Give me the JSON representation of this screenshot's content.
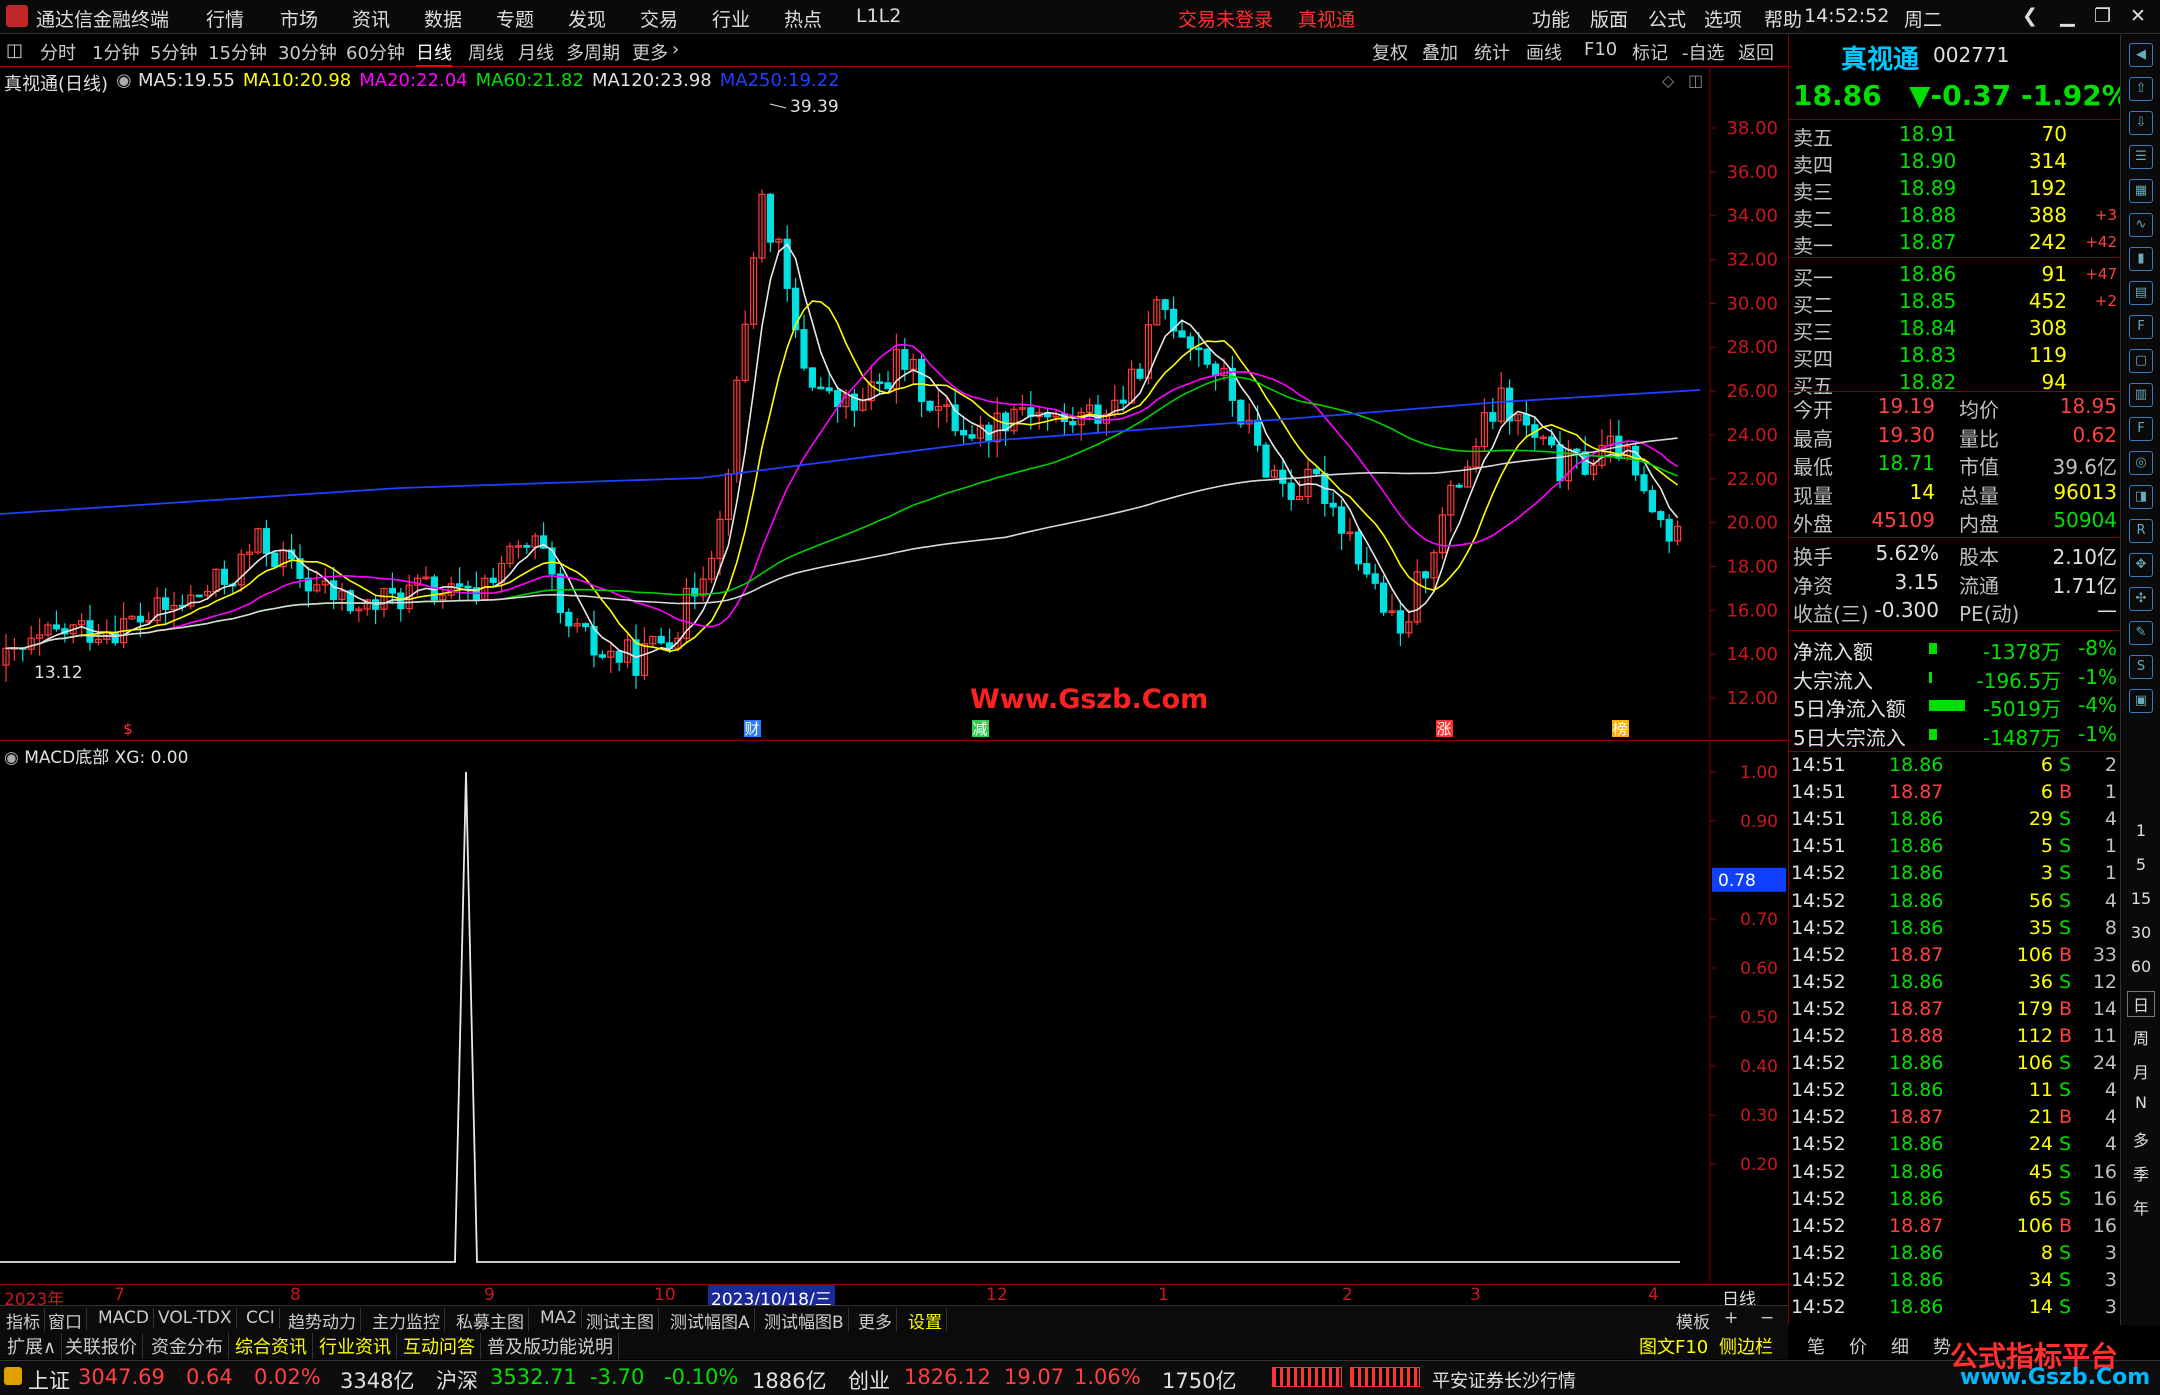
{
  "window": {
    "title": "通达信金融终端",
    "menus": [
      "行情",
      "市场",
      "资讯",
      "数据",
      "专题",
      "发现",
      "交易",
      "行业",
      "热点",
      "L1L2"
    ],
    "trade_status": "交易未登录",
    "stock_link": "真视通",
    "right_menus": [
      "功能",
      "版面",
      "公式",
      "选项",
      "帮助"
    ],
    "clock": "14:52:52",
    "weekday": "周二"
  },
  "period_bar": {
    "items": [
      "分时",
      "1分钟",
      "5分钟",
      "15分钟",
      "30分钟",
      "60分钟",
      "日线",
      "周线",
      "月线",
      "多周期",
      "更多"
    ],
    "active": "日线",
    "right_items": [
      "复权",
      "叠加",
      "统计",
      "画线",
      "F10",
      "标记",
      "-自选",
      "返回"
    ]
  },
  "chart": {
    "title": "真视通(日线)",
    "ma": [
      {
        "label": "MA5:",
        "value": "19.55",
        "color": "#e0e0e0"
      },
      {
        "label": "MA10:",
        "value": "20.98",
        "color": "#ffff00"
      },
      {
        "label": "MA20:",
        "value": "22.04",
        "color": "#ff00ff"
      },
      {
        "label": "MA60:",
        "value": "21.82",
        "color": "#00e000"
      },
      {
        "label": "MA120:",
        "value": "23.98",
        "color": "#e0e0e0"
      },
      {
        "label": "MA250:",
        "value": "19.22",
        "color": "#2040ff"
      }
    ],
    "high_label": "39.39",
    "low_label": "13.12",
    "watermark": "Www.Gszb.Com",
    "markers": [
      "$",
      "财",
      "减",
      "涨",
      "榜"
    ],
    "y_ticks": [
      "38.00",
      "36.00",
      "34.00",
      "32.00",
      "30.00",
      "28.00",
      "26.00",
      "24.00",
      "22.00",
      "20.00",
      "18.00",
      "16.00",
      "14.00",
      "12.00"
    ]
  },
  "indicator": {
    "title": "MACD底部",
    "xg_label": "XG:",
    "xg_value": "0.00",
    "y_ticks": [
      "1.00",
      "0.90",
      "0.78",
      "0.70",
      "0.60",
      "0.50",
      "0.40",
      "0.30",
      "0.20"
    ],
    "current": "0.78"
  },
  "x_axis": {
    "labels": [
      "2023年",
      "7",
      "8",
      "9",
      "10",
      "2023/10/18/三",
      "12",
      "1",
      "2",
      "3",
      "4"
    ],
    "period": "日线"
  },
  "quote": {
    "name": "真视通",
    "code": "002771",
    "price": "18.86",
    "change": "▼-0.37",
    "pct": "-1.92%",
    "asks": [
      {
        "l": "卖五",
        "p": "18.91",
        "v": "70",
        "d": ""
      },
      {
        "l": "卖四",
        "p": "18.90",
        "v": "314",
        "d": ""
      },
      {
        "l": "卖三",
        "p": "18.89",
        "v": "192",
        "d": ""
      },
      {
        "l": "卖二",
        "p": "18.88",
        "v": "388",
        "d": "+3"
      },
      {
        "l": "卖一",
        "p": "18.87",
        "v": "242",
        "d": "+42"
      }
    ],
    "bids": [
      {
        "l": "买一",
        "p": "18.86",
        "v": "91",
        "d": "+47"
      },
      {
        "l": "买二",
        "p": "18.85",
        "v": "452",
        "d": "+2"
      },
      {
        "l": "买三",
        "p": "18.84",
        "v": "308",
        "d": ""
      },
      {
        "l": "买四",
        "p": "18.83",
        "v": "119",
        "d": ""
      },
      {
        "l": "买五",
        "p": "18.82",
        "v": "94",
        "d": ""
      }
    ],
    "stats": [
      [
        "今开",
        "19.19",
        "均价",
        "18.95"
      ],
      [
        "最高",
        "19.30",
        "量比",
        "0.62"
      ],
      [
        "最低",
        "18.71",
        "市值",
        "39.6亿"
      ],
      [
        "现量",
        "14",
        "总量",
        "96013"
      ],
      [
        "外盘",
        "45109",
        "内盘",
        "50904"
      ]
    ],
    "stats2": [
      [
        "换手",
        "5.62%",
        "股本",
        "2.10亿"
      ],
      [
        "净资",
        "3.15",
        "流通",
        "1.71亿"
      ],
      [
        "收益(三)",
        "-0.300",
        "PE(动)",
        "—"
      ]
    ],
    "flows": [
      [
        "净流入额",
        "-1378万",
        "-8%"
      ],
      [
        "大宗流入",
        "-196.5万",
        "-1%"
      ],
      [
        "5日净流入额",
        "-5019万",
        "-4%"
      ],
      [
        "5日大宗流入",
        "-1487万",
        "-1%"
      ]
    ],
    "ticks": [
      [
        "14:51",
        "18.86",
        "6",
        "S",
        "2"
      ],
      [
        "14:51",
        "18.87",
        "6",
        "B",
        "1"
      ],
      [
        "14:51",
        "18.86",
        "29",
        "S",
        "4"
      ],
      [
        "14:51",
        "18.86",
        "5",
        "S",
        "1"
      ],
      [
        "14:52",
        "18.86",
        "3",
        "S",
        "1"
      ],
      [
        "14:52",
        "18.86",
        "56",
        "S",
        "4"
      ],
      [
        "14:52",
        "18.86",
        "35",
        "S",
        "8"
      ],
      [
        "14:52",
        "18.87",
        "106",
        "B",
        "33"
      ],
      [
        "14:52",
        "18.86",
        "36",
        "S",
        "12"
      ],
      [
        "14:52",
        "18.87",
        "179",
        "B",
        "14"
      ],
      [
        "14:52",
        "18.88",
        "112",
        "B",
        "11"
      ],
      [
        "14:52",
        "18.86",
        "106",
        "S",
        "24"
      ],
      [
        "14:52",
        "18.86",
        "11",
        "S",
        "4"
      ],
      [
        "14:52",
        "18.87",
        "21",
        "B",
        "4"
      ],
      [
        "14:52",
        "18.86",
        "24",
        "S",
        "4"
      ],
      [
        "14:52",
        "18.86",
        "45",
        "S",
        "16"
      ],
      [
        "14:52",
        "18.86",
        "65",
        "S",
        "16"
      ],
      [
        "14:52",
        "18.87",
        "106",
        "B",
        "16"
      ],
      [
        "14:52",
        "18.86",
        "8",
        "S",
        "3"
      ],
      [
        "14:52",
        "18.86",
        "34",
        "S",
        "3"
      ],
      [
        "14:52",
        "18.86",
        "14",
        "S",
        "3"
      ]
    ]
  },
  "side_icons": [
    "1",
    "5",
    "15",
    "30",
    "60",
    "日",
    "周",
    "月",
    "N",
    "多",
    "季",
    "年"
  ],
  "tabs1": [
    "指标",
    "窗口",
    "MACD",
    "VOL-TDX",
    "CCI",
    "趋势动力",
    "主力监控",
    "私募主图",
    "MA2",
    "测试主图",
    "测试幅图A",
    "测试幅图B",
    "更多",
    "设置"
  ],
  "tabs1_right": [
    "模板",
    "+",
    "−"
  ],
  "tabs2": [
    "扩展∧",
    "关联报价",
    "资金分布",
    "综合资讯",
    "行业资讯",
    "互动问答",
    "普及版功能说明"
  ],
  "tabs2_right": [
    "图文F10",
    "侧边栏《",
    "笔",
    "价",
    "细",
    "势"
  ],
  "status": {
    "sh_label": "上证",
    "sh": "3047.69",
    "sh_ch": "0.64",
    "sh_pct": "0.02%",
    "sh_amt": "3348亿",
    "hs_label": "沪深",
    "hs": "3532.71",
    "hs_ch": "-3.70",
    "hs_pct": "-0.10%",
    "hs_amt": "1886亿",
    "cy_label": "创业",
    "cy": "1826.12",
    "cy_ch": "19.07",
    "cy_pct": "1.06%",
    "cy_amt": "1750亿",
    "broker": "平安证券长沙行情",
    "brand": "公式指标平台",
    "brand_url": "www.Gszb.Com"
  }
}
